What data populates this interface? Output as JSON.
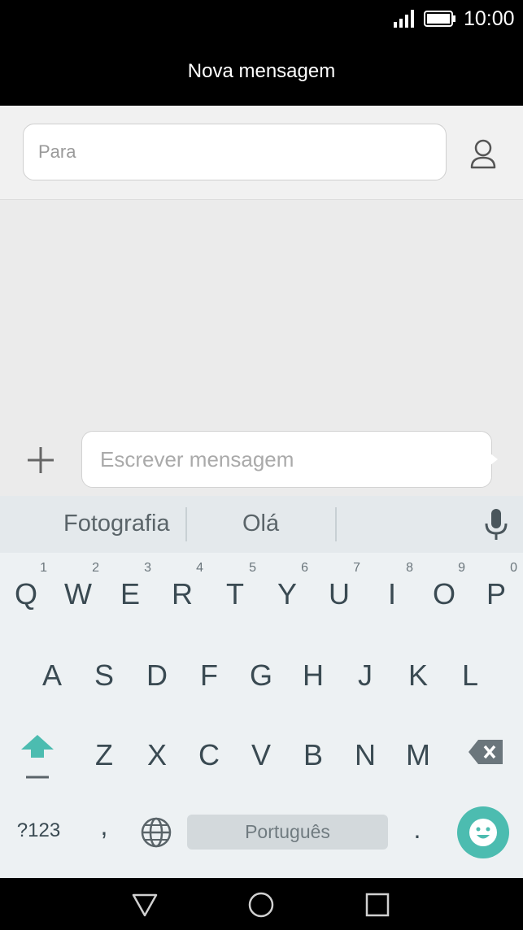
{
  "status_bar": {
    "time": "10:00"
  },
  "header": {
    "title": "Nova mensagem"
  },
  "recipient": {
    "placeholder": "Para",
    "contact_icon": "person-icon"
  },
  "composer": {
    "placeholder": "Escrever mensagem",
    "attach_icon": "plus-icon"
  },
  "keyboard": {
    "suggestions": [
      "Fotografia",
      "Olá"
    ],
    "mic_icon": "microphone-icon",
    "row1": [
      {
        "key": "Q",
        "hint": "1"
      },
      {
        "key": "W",
        "hint": "2"
      },
      {
        "key": "E",
        "hint": "3"
      },
      {
        "key": "R",
        "hint": "4"
      },
      {
        "key": "T",
        "hint": "5"
      },
      {
        "key": "Y",
        "hint": "6"
      },
      {
        "key": "U",
        "hint": "7"
      },
      {
        "key": "I",
        "hint": "8"
      },
      {
        "key": "O",
        "hint": "9"
      },
      {
        "key": "P",
        "hint": "0"
      }
    ],
    "row2": [
      "A",
      "S",
      "D",
      "F",
      "G",
      "H",
      "J",
      "K",
      "L"
    ],
    "row3": [
      "Z",
      "X",
      "C",
      "V",
      "B",
      "N",
      "M"
    ],
    "symbols_label": "?123",
    "comma": ",",
    "language_label": "Português",
    "period": ".",
    "accent_color": "#4cbcb0"
  },
  "nav_bar": {
    "back_icon": "triangle-back-icon",
    "home_icon": "circle-home-icon",
    "recents_icon": "square-recents-icon"
  }
}
